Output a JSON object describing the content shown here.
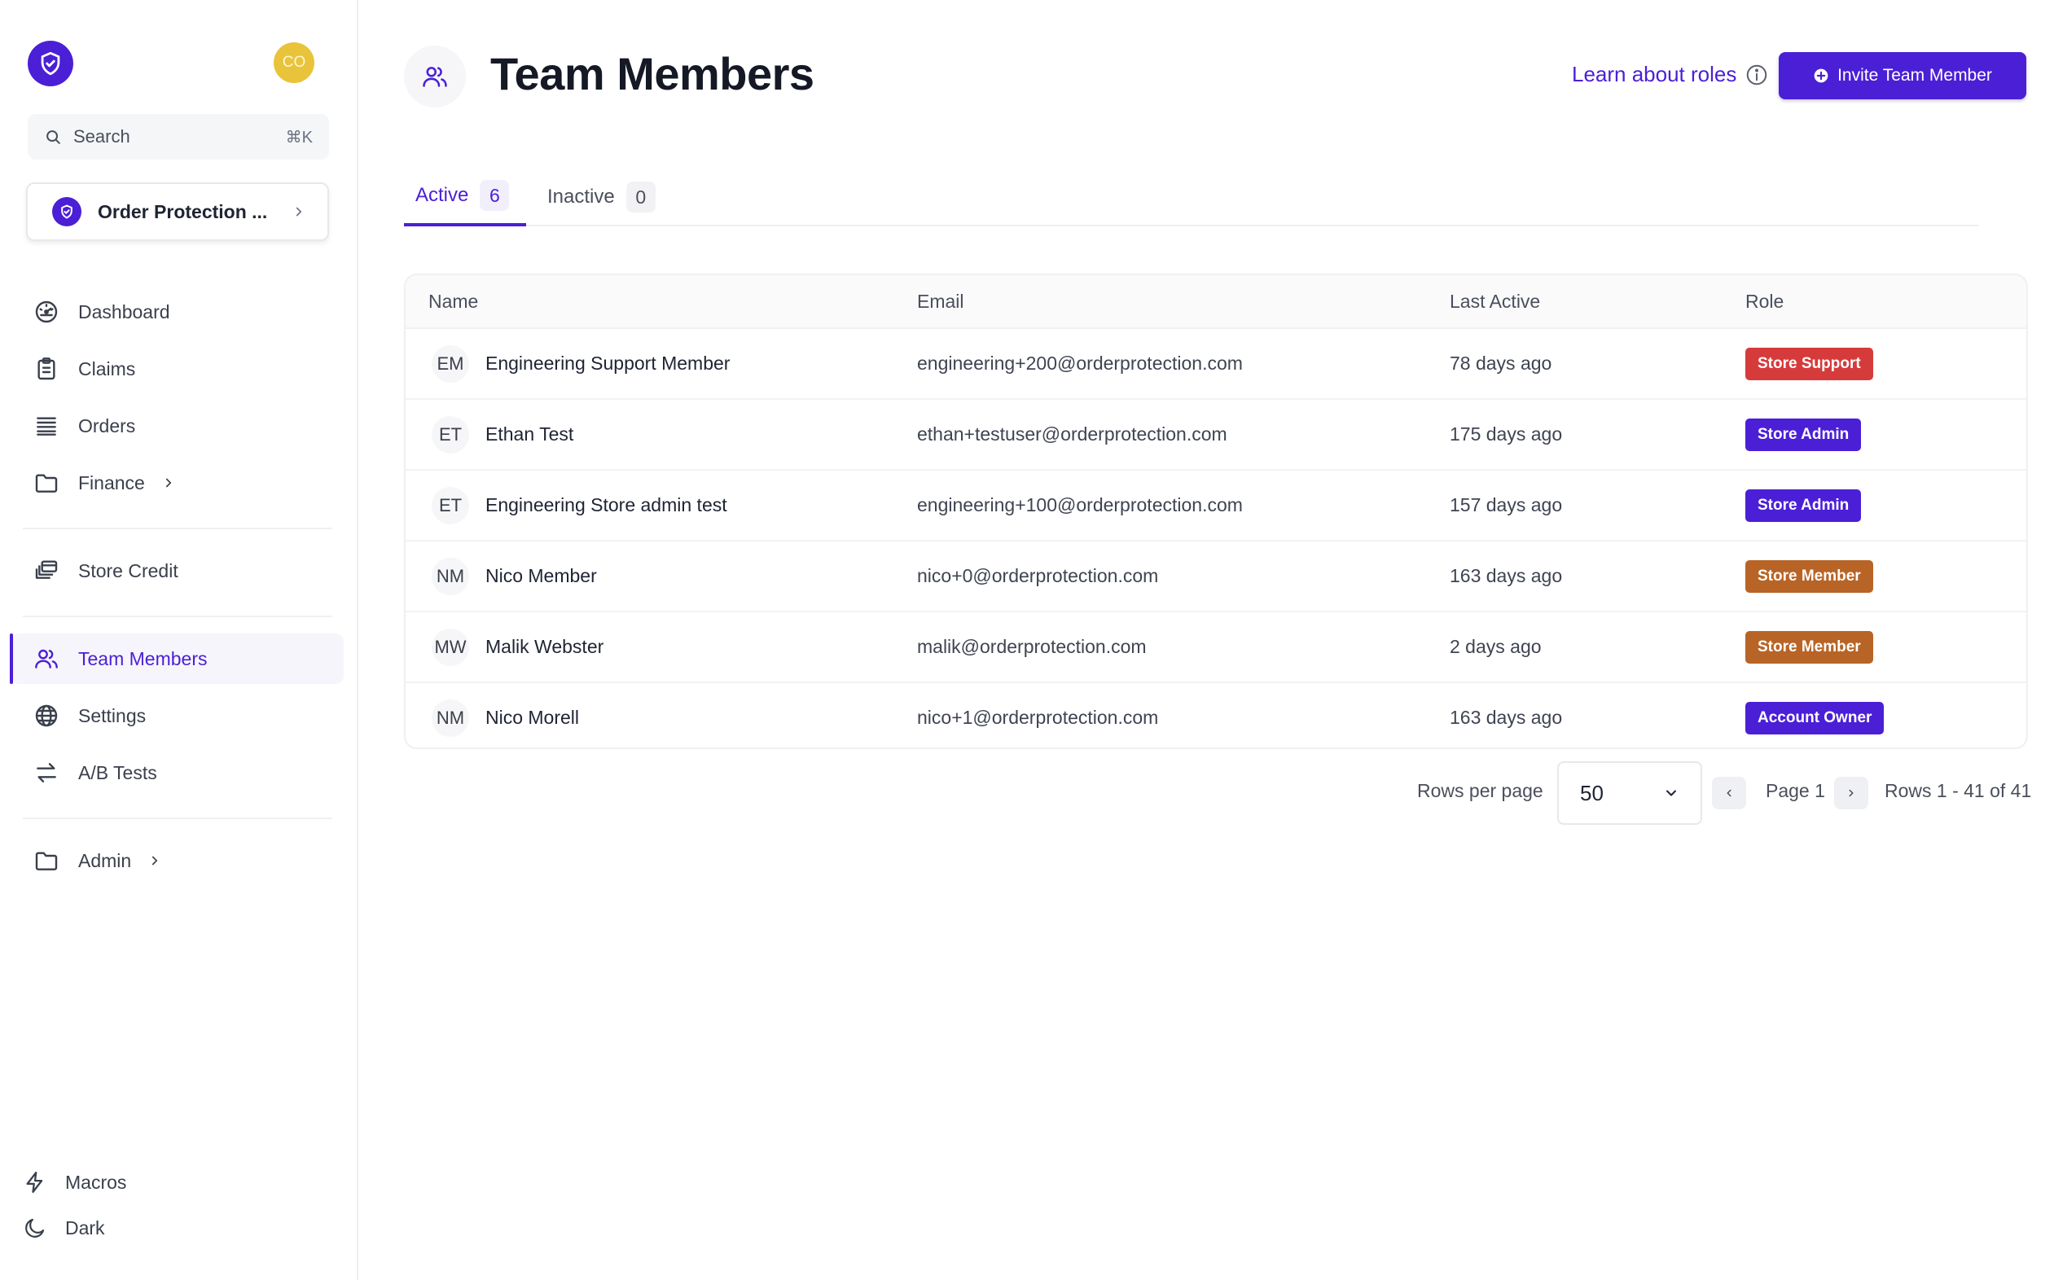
{
  "user": {
    "initials": "CO",
    "avatar_color": "#e9c33a"
  },
  "brand": {
    "accent": "#4b1fd6"
  },
  "search": {
    "label": "Search",
    "shortcut": "⌘K"
  },
  "store": {
    "name": "Order Protection ..."
  },
  "sidebar": {
    "items": [
      {
        "label": "Dashboard",
        "icon": "dashboard-icon"
      },
      {
        "label": "Claims",
        "icon": "clipboard-icon"
      },
      {
        "label": "Orders",
        "icon": "list-icon"
      },
      {
        "label": "Finance",
        "icon": "folder-icon"
      },
      {
        "label": "Store Credit",
        "icon": "store-credit-icon"
      },
      {
        "label": "Team Members",
        "icon": "users-icon",
        "active": true
      },
      {
        "label": "Settings",
        "icon": "globe-icon"
      },
      {
        "label": "A/B Tests",
        "icon": "arrows-icon"
      },
      {
        "label": "Admin",
        "icon": "folder-icon"
      }
    ],
    "bottom": [
      {
        "label": "Macros",
        "icon": "bolt-icon"
      },
      {
        "label": "Dark",
        "icon": "moon-icon"
      }
    ]
  },
  "header": {
    "title": "Team Members",
    "learn_link": "Learn about roles",
    "invite_button": "Invite Team Member"
  },
  "tabs": [
    {
      "label": "Active",
      "count": "6"
    },
    {
      "label": "Inactive",
      "count": "0"
    }
  ],
  "table": {
    "columns": [
      "Name",
      "Email",
      "Last Active",
      "Role"
    ],
    "rows": [
      {
        "initials": "EM",
        "name": "Engineering Support Member",
        "email": "engineering+200@orderprotection.com",
        "last_active": "78 days ago",
        "role": "Store Support",
        "role_color": "#d63b3b"
      },
      {
        "initials": "ET",
        "name": "Ethan Test",
        "email": "ethan+testuser@orderprotection.com",
        "last_active": "175 days ago",
        "role": "Store Admin",
        "role_color": "#4b1fd6"
      },
      {
        "initials": "ET",
        "name": "Engineering Store admin test",
        "email": "engineering+100@orderprotection.com",
        "last_active": "157 days ago",
        "role": "Store Admin",
        "role_color": "#4b1fd6"
      },
      {
        "initials": "NM",
        "name": "Nico Member",
        "email": "nico+0@orderprotection.com",
        "last_active": "163 days ago",
        "role": "Store Member",
        "role_color": "#b86426"
      },
      {
        "initials": "MW",
        "name": "Malik Webster",
        "email": "malik@orderprotection.com",
        "last_active": "2 days ago",
        "role": "Store Member",
        "role_color": "#b86426"
      },
      {
        "initials": "NM",
        "name": "Nico Morell",
        "email": "nico+1@orderprotection.com",
        "last_active": "163 days ago",
        "role": "Account Owner",
        "role_color": "#4b1fd6"
      }
    ]
  },
  "pagination": {
    "rows_per_page_label": "Rows per page",
    "rows_per_page_value": "50",
    "page_label": "Page 1",
    "range_label": "Rows 1 - 41 of 41"
  }
}
